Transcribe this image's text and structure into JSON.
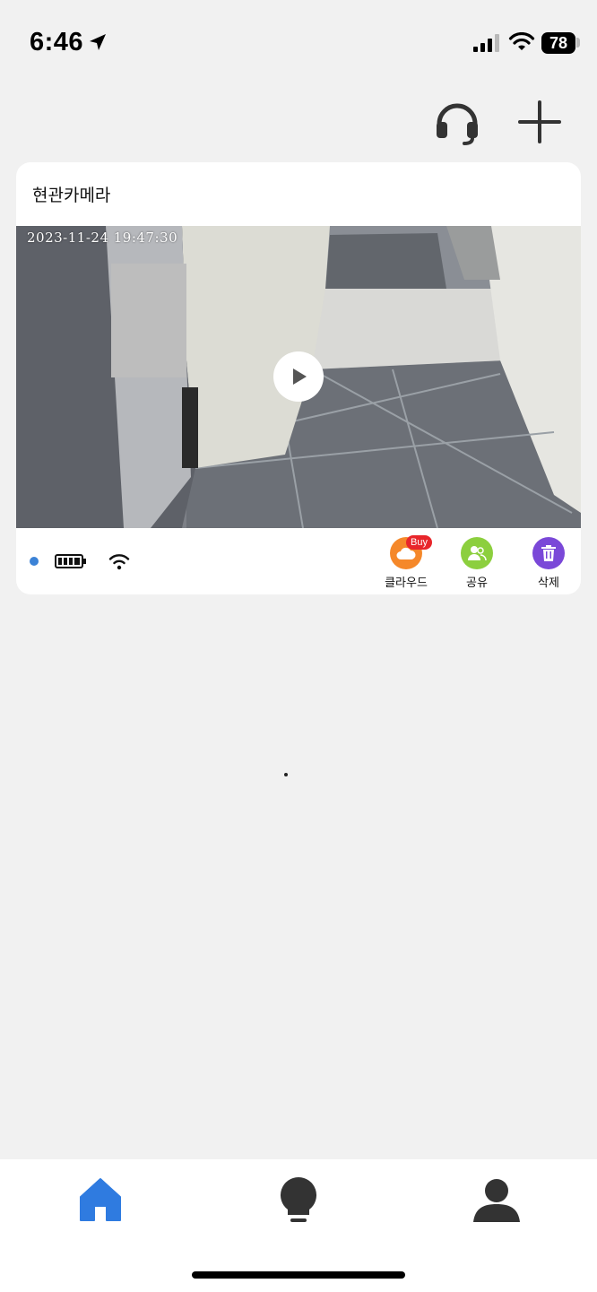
{
  "status_bar": {
    "time": "6:46",
    "battery_level": "78",
    "icons": [
      "location-arrow-icon",
      "cellular-signal-icon",
      "wifi-icon",
      "battery-icon"
    ]
  },
  "header": {
    "icons": [
      "headset-icon",
      "plus-icon"
    ]
  },
  "device_card": {
    "name": "현관카메라",
    "preview": {
      "timestamp": "2023-11-24 19:47:30",
      "icons": [
        "play-icon"
      ]
    },
    "status": {
      "online_color": "#3b82d6",
      "battery_full": true,
      "icons": [
        "battery-full-icon",
        "wifi-icon"
      ]
    },
    "actions": [
      {
        "label": "클라우드",
        "badge": "Buy",
        "icon": "cloud-icon",
        "color": "#f5882a"
      },
      {
        "label": "공유",
        "icon": "users-icon",
        "color": "#8ccf3e"
      },
      {
        "label": "삭제",
        "icon": "trash-icon",
        "color": "#7a48d8"
      }
    ]
  },
  "bottom_nav": {
    "items": [
      {
        "icon": "home-icon",
        "active": true,
        "color": "#2f7be0"
      },
      {
        "icon": "lightbulb-icon",
        "active": false,
        "color": "#333333"
      },
      {
        "icon": "user-icon",
        "active": false,
        "color": "#333333"
      }
    ]
  }
}
